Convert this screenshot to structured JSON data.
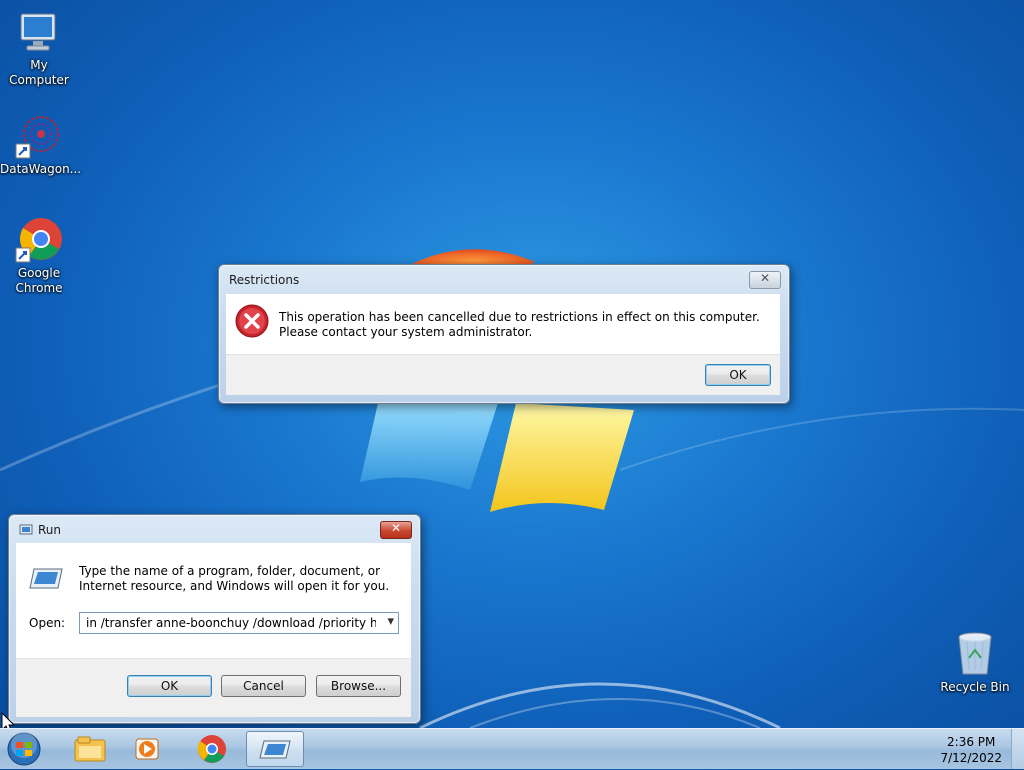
{
  "desktop": {
    "icons": [
      {
        "label": "My Computer",
        "icon": "my-computer-icon"
      },
      {
        "label": "DataWagon...",
        "icon": "datawagon-shortcut-icon"
      },
      {
        "label": "Google Chrome",
        "icon": "chrome-icon"
      },
      {
        "label": "Recycle Bin",
        "icon": "recycle-bin-icon"
      }
    ]
  },
  "restrictions_dialog": {
    "title": "Restrictions",
    "message": "This operation has been cancelled due to restrictions in effect on this computer. Please contact your system administrator.",
    "ok_label": "OK",
    "close_glyph": "✕",
    "icon": "error-icon"
  },
  "run_dialog": {
    "title": "Run",
    "description": "Type the name of a program, folder, document, or Internet resource, and Windows will open it for you.",
    "open_label": "Open:",
    "open_value": "in /transfer anne-boonchuy /download /priority high h",
    "ok_label": "OK",
    "cancel_label": "Cancel",
    "browse_label": "Browse...",
    "close_glyph": "✕",
    "dropdown_glyph": "▾"
  },
  "taskbar": {
    "items": [
      "start-orb-icon",
      "explorer-icon",
      "media-player-icon",
      "chrome-icon",
      "run-icon"
    ],
    "clock_time": "2:36 PM",
    "clock_date": "7/12/2022"
  },
  "colors": {
    "accent": "#1a78cf",
    "error_red": "#d4313a",
    "close_red": "#c9472f"
  }
}
